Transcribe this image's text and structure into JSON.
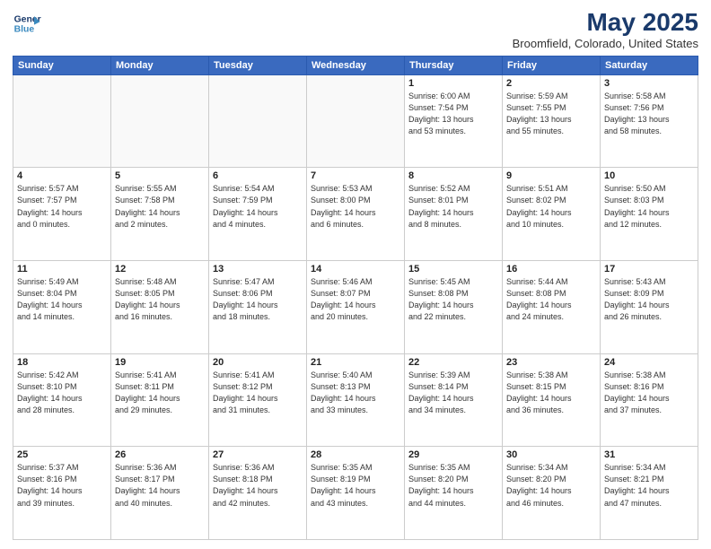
{
  "header": {
    "logo_line1": "General",
    "logo_line2": "Blue",
    "title": "May 2025",
    "subtitle": "Broomfield, Colorado, United States"
  },
  "days_of_week": [
    "Sunday",
    "Monday",
    "Tuesday",
    "Wednesday",
    "Thursday",
    "Friday",
    "Saturday"
  ],
  "weeks": [
    [
      {
        "day": "",
        "info": ""
      },
      {
        "day": "",
        "info": ""
      },
      {
        "day": "",
        "info": ""
      },
      {
        "day": "",
        "info": ""
      },
      {
        "day": "1",
        "info": "Sunrise: 6:00 AM\nSunset: 7:54 PM\nDaylight: 13 hours\nand 53 minutes."
      },
      {
        "day": "2",
        "info": "Sunrise: 5:59 AM\nSunset: 7:55 PM\nDaylight: 13 hours\nand 55 minutes."
      },
      {
        "day": "3",
        "info": "Sunrise: 5:58 AM\nSunset: 7:56 PM\nDaylight: 13 hours\nand 58 minutes."
      }
    ],
    [
      {
        "day": "4",
        "info": "Sunrise: 5:57 AM\nSunset: 7:57 PM\nDaylight: 14 hours\nand 0 minutes."
      },
      {
        "day": "5",
        "info": "Sunrise: 5:55 AM\nSunset: 7:58 PM\nDaylight: 14 hours\nand 2 minutes."
      },
      {
        "day": "6",
        "info": "Sunrise: 5:54 AM\nSunset: 7:59 PM\nDaylight: 14 hours\nand 4 minutes."
      },
      {
        "day": "7",
        "info": "Sunrise: 5:53 AM\nSunset: 8:00 PM\nDaylight: 14 hours\nand 6 minutes."
      },
      {
        "day": "8",
        "info": "Sunrise: 5:52 AM\nSunset: 8:01 PM\nDaylight: 14 hours\nand 8 minutes."
      },
      {
        "day": "9",
        "info": "Sunrise: 5:51 AM\nSunset: 8:02 PM\nDaylight: 14 hours\nand 10 minutes."
      },
      {
        "day": "10",
        "info": "Sunrise: 5:50 AM\nSunset: 8:03 PM\nDaylight: 14 hours\nand 12 minutes."
      }
    ],
    [
      {
        "day": "11",
        "info": "Sunrise: 5:49 AM\nSunset: 8:04 PM\nDaylight: 14 hours\nand 14 minutes."
      },
      {
        "day": "12",
        "info": "Sunrise: 5:48 AM\nSunset: 8:05 PM\nDaylight: 14 hours\nand 16 minutes."
      },
      {
        "day": "13",
        "info": "Sunrise: 5:47 AM\nSunset: 8:06 PM\nDaylight: 14 hours\nand 18 minutes."
      },
      {
        "day": "14",
        "info": "Sunrise: 5:46 AM\nSunset: 8:07 PM\nDaylight: 14 hours\nand 20 minutes."
      },
      {
        "day": "15",
        "info": "Sunrise: 5:45 AM\nSunset: 8:08 PM\nDaylight: 14 hours\nand 22 minutes."
      },
      {
        "day": "16",
        "info": "Sunrise: 5:44 AM\nSunset: 8:08 PM\nDaylight: 14 hours\nand 24 minutes."
      },
      {
        "day": "17",
        "info": "Sunrise: 5:43 AM\nSunset: 8:09 PM\nDaylight: 14 hours\nand 26 minutes."
      }
    ],
    [
      {
        "day": "18",
        "info": "Sunrise: 5:42 AM\nSunset: 8:10 PM\nDaylight: 14 hours\nand 28 minutes."
      },
      {
        "day": "19",
        "info": "Sunrise: 5:41 AM\nSunset: 8:11 PM\nDaylight: 14 hours\nand 29 minutes."
      },
      {
        "day": "20",
        "info": "Sunrise: 5:41 AM\nSunset: 8:12 PM\nDaylight: 14 hours\nand 31 minutes."
      },
      {
        "day": "21",
        "info": "Sunrise: 5:40 AM\nSunset: 8:13 PM\nDaylight: 14 hours\nand 33 minutes."
      },
      {
        "day": "22",
        "info": "Sunrise: 5:39 AM\nSunset: 8:14 PM\nDaylight: 14 hours\nand 34 minutes."
      },
      {
        "day": "23",
        "info": "Sunrise: 5:38 AM\nSunset: 8:15 PM\nDaylight: 14 hours\nand 36 minutes."
      },
      {
        "day": "24",
        "info": "Sunrise: 5:38 AM\nSunset: 8:16 PM\nDaylight: 14 hours\nand 37 minutes."
      }
    ],
    [
      {
        "day": "25",
        "info": "Sunrise: 5:37 AM\nSunset: 8:16 PM\nDaylight: 14 hours\nand 39 minutes."
      },
      {
        "day": "26",
        "info": "Sunrise: 5:36 AM\nSunset: 8:17 PM\nDaylight: 14 hours\nand 40 minutes."
      },
      {
        "day": "27",
        "info": "Sunrise: 5:36 AM\nSunset: 8:18 PM\nDaylight: 14 hours\nand 42 minutes."
      },
      {
        "day": "28",
        "info": "Sunrise: 5:35 AM\nSunset: 8:19 PM\nDaylight: 14 hours\nand 43 minutes."
      },
      {
        "day": "29",
        "info": "Sunrise: 5:35 AM\nSunset: 8:20 PM\nDaylight: 14 hours\nand 44 minutes."
      },
      {
        "day": "30",
        "info": "Sunrise: 5:34 AM\nSunset: 8:20 PM\nDaylight: 14 hours\nand 46 minutes."
      },
      {
        "day": "31",
        "info": "Sunrise: 5:34 AM\nSunset: 8:21 PM\nDaylight: 14 hours\nand 47 minutes."
      }
    ]
  ]
}
